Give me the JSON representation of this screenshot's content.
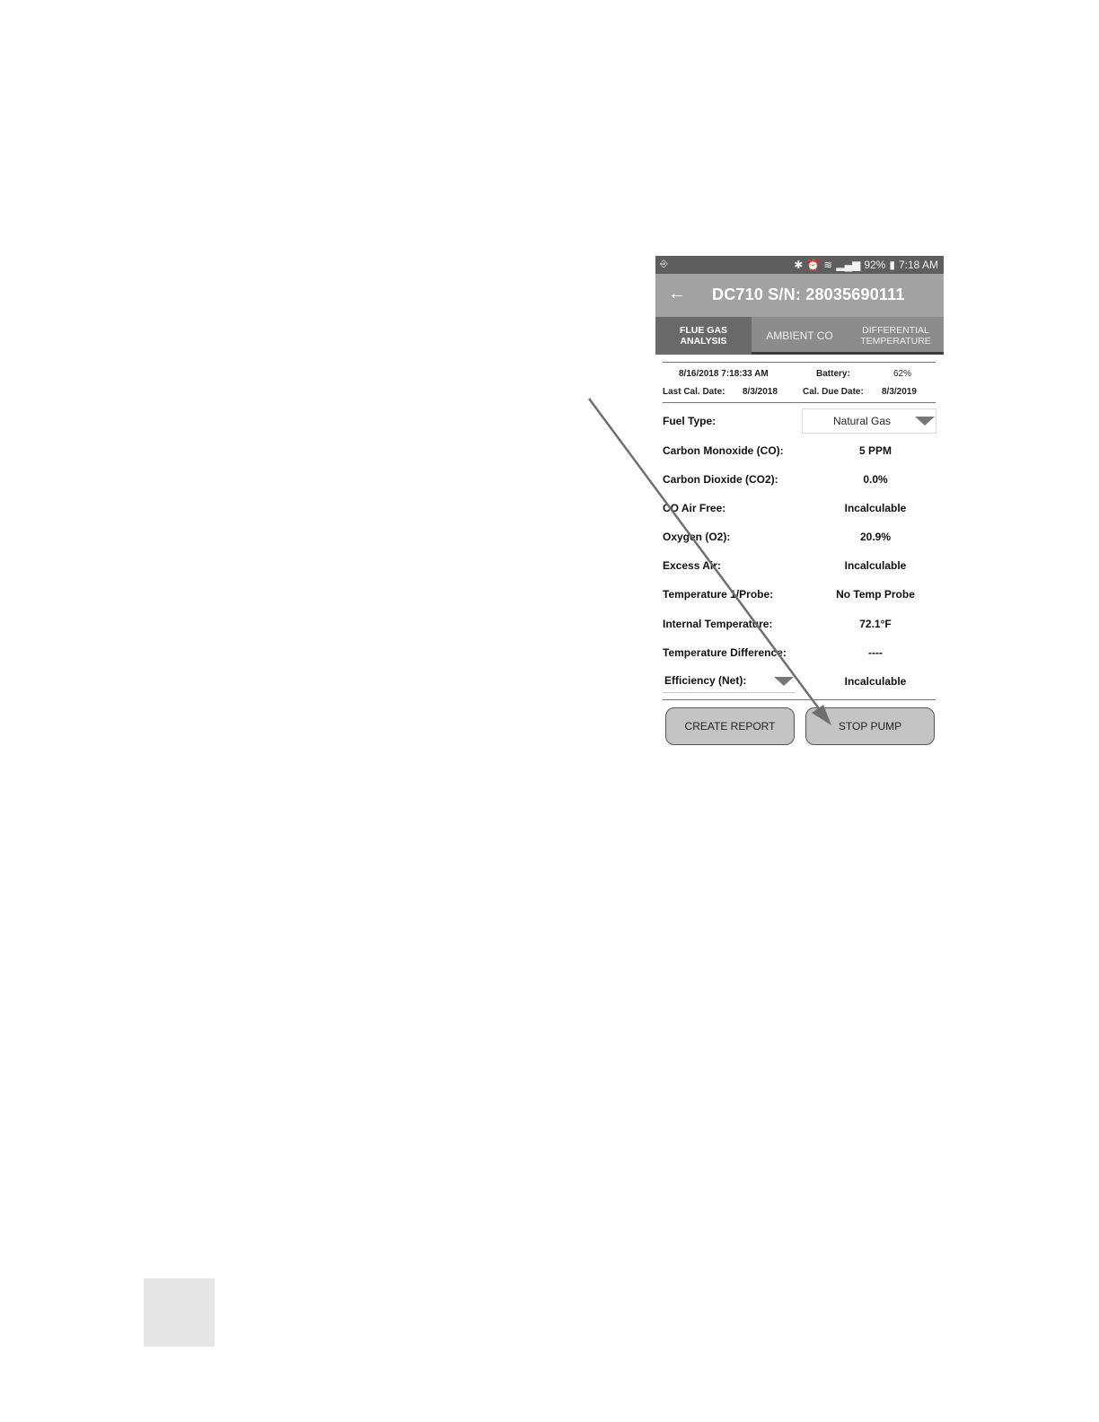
{
  "status_bar": {
    "left_icon": "screen-mirror-icon",
    "icons": [
      "bluetooth-icon",
      "alarm-icon",
      "wifi-icon",
      "signal-icon"
    ],
    "battery": "92%",
    "time": "7:18 AM"
  },
  "app_bar": {
    "back_icon": "arrow-left-icon",
    "title": "DC710 S/N: 28035690111"
  },
  "tabs": [
    {
      "label_line1": "FLUE GAS",
      "label_line2": "ANALYSIS",
      "active": true
    },
    {
      "label_line1": "AMBIENT CO",
      "label_line2": "",
      "active": false
    },
    {
      "label_line1": "DIFFERENTIAL",
      "label_line2": "TEMPERATURE",
      "active": false
    }
  ],
  "info": {
    "datetime": "8/16/2018 7:18:33 AM",
    "battery_label": "Battery:",
    "battery_value": "62%",
    "last_cal_label": "Last Cal. Date:",
    "last_cal_value": "8/3/2018",
    "cal_due_label": "Cal. Due Date:",
    "cal_due_value": "8/3/2019"
  },
  "fuel": {
    "label": "Fuel Type:",
    "value": "Natural Gas"
  },
  "readings": [
    {
      "label": "Carbon Monoxide (CO):",
      "value": "5 PPM"
    },
    {
      "label": "Carbon Dioxide (CO2):",
      "value": "0.0%"
    },
    {
      "label": "CO Air Free:",
      "value": "Incalculable"
    },
    {
      "label": "Oxygen (O2):",
      "value": "20.9%"
    },
    {
      "label": "Excess Air:",
      "value": "Incalculable"
    },
    {
      "label": "Temperature 1/Probe:",
      "value": "No Temp Probe"
    },
    {
      "label": "Internal Temperature:",
      "value": "72.1°F"
    },
    {
      "label": "Temperature Difference:",
      "value": "----"
    }
  ],
  "efficiency": {
    "label": "Efficiency (Net):",
    "value": "Incalculable"
  },
  "buttons": {
    "create_report": "CREATE REPORT",
    "stop_pump": "STOP PUMP"
  }
}
